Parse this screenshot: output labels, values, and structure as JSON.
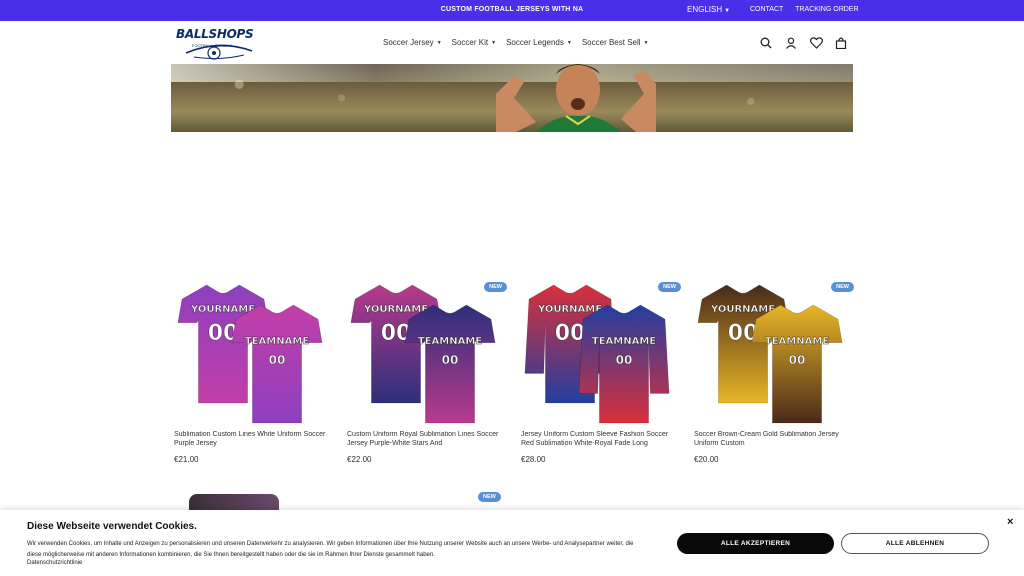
{
  "topbar": {
    "promo": "CUSTOM FOOTBALL JERSEYS WITH NA",
    "language": "ENGLISH",
    "contact": "CONTACT",
    "tracking": "TRACKING ORDER"
  },
  "logo": {
    "brand": "BALLSHOPS",
    "tagline": "FOOTBALL JERSEYS"
  },
  "nav": [
    {
      "label": "Soccer Jersey"
    },
    {
      "label": "Soccer Kit"
    },
    {
      "label": "Soccer Legends"
    },
    {
      "label": "Soccer Best Sell"
    }
  ],
  "header_icons": [
    "search-icon",
    "account-icon",
    "wishlist-icon",
    "cart-icon"
  ],
  "products": [
    {
      "title": "Sublimation Custom Lines White Uniform Soccer Purple Jersey",
      "price": "€21.00",
      "badge": "",
      "front_text": "YOURNAME",
      "back_text": "TEAMNAME",
      "number": "00",
      "colors": [
        "#8e3fbf",
        "#c23fa8"
      ]
    },
    {
      "title": "Custom Uniform Royal Sublimation Lines Soccer Jersey Purple-White Stars And",
      "price": "€22.00",
      "badge": "NEW",
      "front_text": "YOURNAME",
      "back_text": "TEAMNAME",
      "number": "00",
      "colors": [
        "#b83a8c",
        "#2d2f7a"
      ]
    },
    {
      "title": "Jersey Uniform Custom Sleeve Fashion Soccer Red Sublimation White-Royal Fade Long",
      "price": "€28.00",
      "badge": "NEW",
      "front_text": "YOURNAME",
      "back_text": "TEAMNAME",
      "number": "00",
      "colors": [
        "#d9303a",
        "#223fa0"
      ]
    },
    {
      "title": "Soccer Brown-Cream Gold Sublimation Jersey Uniform Custom",
      "price": "€20.00",
      "badge": "NEW",
      "front_text": "YOURNAME",
      "back_text": "TEAMNAME",
      "number": "00",
      "colors": [
        "#4a2a1a",
        "#e8b627"
      ]
    }
  ],
  "next_row_badge": "NEW",
  "cookie": {
    "title": "Diese Webseite verwendet Cookies.",
    "text": "Wir verwenden Cookies, um Inhalte und Anzeigen zu personalisieren und unseren Datenverkehr zu analysieren. Wir geben Informationen über Ihre Nutzung unserer Website auch an unsere Werbe- und Analysepartner weiter, die diese möglicherweise mit anderen Informationen kombinieren, die Sie Ihnen bereitgestellt haben oder die sie im Rahmen Ihrer Dienste gesammelt haben.",
    "link": "Datenschutzrichtlinie",
    "accept": "ALLE AKZEPTIEREN",
    "decline": "ALLE ABLEHNEN",
    "close": "×"
  },
  "colors": {
    "topbar": "#4b2ee8",
    "badge": "#5a8fd6",
    "accept": "#0a0a0a"
  }
}
